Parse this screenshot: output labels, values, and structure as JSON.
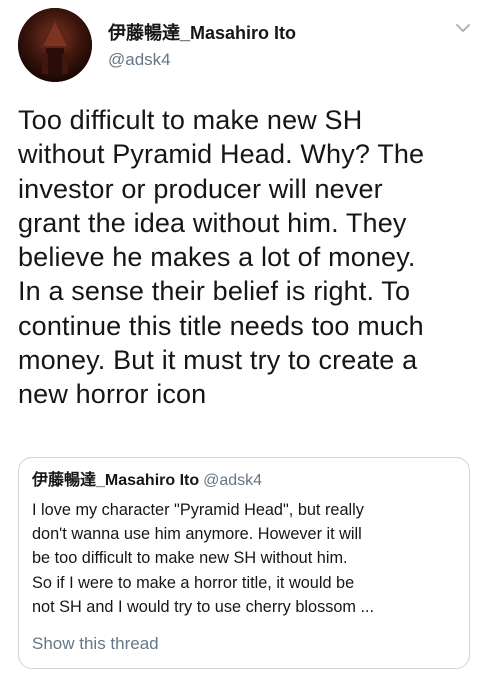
{
  "tweet": {
    "author": {
      "display_name": "伊藤暢達_Masahiro Ito",
      "handle": "@adsk4"
    },
    "text": "Too difficult to make new SH\nwithout Pyramid Head. Why? The\ninvestor or producer will never\ngrant the idea without him. They\nbelieve he makes a lot of money.\nIn a sense their belief is right. To\ncontinue this title needs too much\nmoney. But it must try to create a\nnew horror icon",
    "menu_icon": "chevron-down-icon"
  },
  "quoted_tweet": {
    "author": {
      "display_name": "伊藤暢達_Masahiro Ito",
      "handle": "@adsk4"
    },
    "text": "I love my character \"Pyramid Head\", but really\ndon't wanna use him anymore. However it will\nbe too difficult to make new SH without him.\nSo if I were to make a horror title, it would be\nnot SH and I would try to use cherry blossom ...",
    "show_thread_label": "Show this thread"
  },
  "colors": {
    "text_primary": "#14171a",
    "text_secondary": "#657786",
    "border": "#ccd6dd"
  }
}
